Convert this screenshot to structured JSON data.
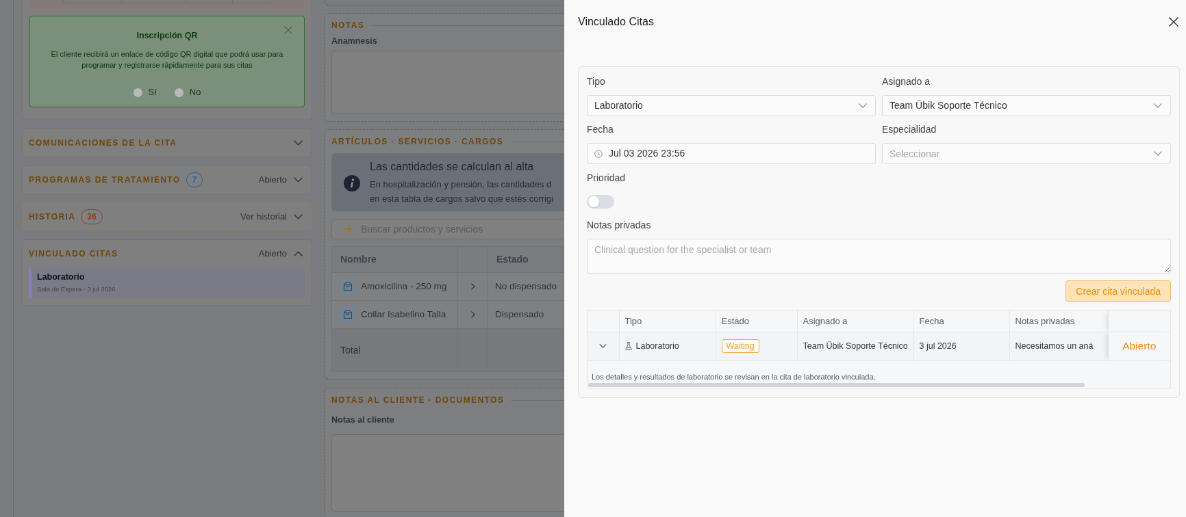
{
  "page": {
    "qr_enrollment": {
      "title": "Inscripción QR",
      "text": "El cliente recibirá un enlace de código QR digital que podrá usar para programar y registrarse rápidamente para sus citas",
      "options": [
        {
          "label": "Sí",
          "selected": false
        },
        {
          "label": "No",
          "selected": false
        }
      ]
    },
    "sections": [
      {
        "title": "COMUNICACIONES DE LA CITA",
        "expanded": false,
        "highlighted": false
      },
      {
        "title": "PROGRAMAS DE TRATAMIENTO",
        "badge": {
          "text": "7",
          "color": "#2c6591"
        },
        "status": "Abierto",
        "expanded": false,
        "highlighted": false
      },
      {
        "title": "HISTORIA",
        "badge": {
          "text": "36",
          "color": "#9c3a16"
        },
        "status": "Ver historial",
        "expanded": false,
        "highlighted": true
      },
      {
        "title": "VINCULADO CITAS",
        "status": "Abierto",
        "expanded": true,
        "highlighted": false,
        "items": [
          {
            "title": "Laboratorio",
            "subtitle": "Sala de Espera - 3 jul 2026"
          }
        ]
      }
    ],
    "notes": {
      "title": "NOTAS",
      "field_label": "Anamnesis"
    },
    "charges": {
      "title": "ARTÍCULOS · SERVICIOS · CARGOS",
      "alert": {
        "title": "Las cantidades se calculan al alta",
        "lines": [
          "En hospitalización y pensión, las cantidades d",
          "en esta tabla de cargos salvo que estés corrigi"
        ]
      },
      "search": {
        "placeholder": "Buscar productos y servicios"
      },
      "table": {
        "columns": {
          "name": "Nombre",
          "status": "Estado"
        },
        "rows": [
          {
            "name": "Amoxicilina - 250 mg",
            "status": "No dispensado"
          },
          {
            "name": "Collar Isabelino Talla",
            "status": "Dispensado"
          }
        ],
        "total_label": "Total"
      }
    },
    "client_notes": {
      "title": "NOTAS AL CLIENTE · DOCUMENTOS",
      "field_label": "Notas al cliente"
    }
  },
  "drawer": {
    "title": "Vinculado Citas",
    "fields": [
      {
        "kind": "select",
        "label": "Tipo",
        "value": "Laboratorio"
      },
      {
        "kind": "select",
        "label": "Asignado a",
        "value": "Team Übik Soporte Técnico"
      },
      {
        "kind": "date",
        "label": "Fecha",
        "value": "Jul 03 2026 23:56"
      },
      {
        "kind": "select",
        "label": "Especialidad",
        "placeholder": "Seleccionar"
      }
    ],
    "priority": {
      "label": "Prioridad",
      "on": false
    },
    "private_notes": {
      "label": "Notas privadas",
      "placeholder": "Clinical question for the specialist or team"
    },
    "submit": "Crear cita vinculada",
    "table": {
      "columns": [
        "Tipo",
        "Estado",
        "Asignado a",
        "Fecha",
        "Notas privadas"
      ],
      "rows": [
        {
          "expanded": false,
          "type": "Laboratorio",
          "status": "Waiting",
          "assignee": "Team Übik Soporte Técnico",
          "date": "3 jul 2026",
          "notes": "Necesitamos un aná",
          "action": "Abierto"
        }
      ],
      "footnote": "Los detalles y resultados de laboratorio se revisan en la cita de laboratorio vinculada."
    }
  }
}
